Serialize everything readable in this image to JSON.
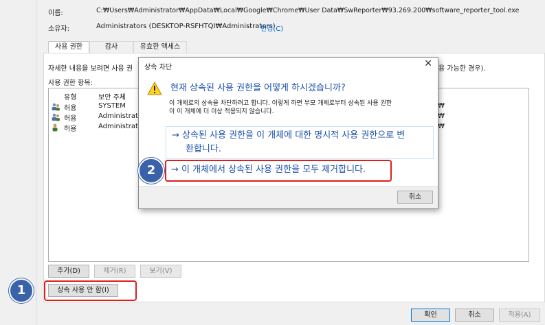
{
  "header": {
    "name_label": "이름:",
    "name_value": "C:₩Users₩Administrator₩AppData₩Local₩Google₩Chrome₩User Data₩SwReporter₩93.269.200₩software_reporter_tool.exe",
    "owner_label": "소유자:",
    "owner_value": "Administrators (DESKTOP-RSFHTQI₩Administrators)",
    "owner_change": "변경(C)"
  },
  "tabs": [
    {
      "label": "사용 권한"
    },
    {
      "label": "감사"
    },
    {
      "label": "유효한 액세스"
    }
  ],
  "permissions": {
    "info_left": "자세한 내용을 보려면 사용 권",
    "info_right": "용 가능한 경우).",
    "entries_label": "사용 권한 항목:",
    "columns": {
      "type": "유형",
      "principal": "보안 주체"
    },
    "rows": [
      {
        "type": "허용",
        "principal": "SYSTEM",
        "tail": "₩"
      },
      {
        "type": "허용",
        "principal": "Administrato",
        "tail": "₩"
      },
      {
        "type": "허용",
        "principal": "Administrato",
        "tail": "₩"
      }
    ]
  },
  "buttons": {
    "add": "추가(D)",
    "remove": "제거(R)",
    "view": "보기(V)",
    "disable_inheritance": "상속 사용 안 함(I)",
    "ok": "확인",
    "cancel": "취소",
    "apply": "적용(A)"
  },
  "dialog": {
    "title": "상속 차단",
    "close": "✕",
    "heading": "현재 상속된 사용 권한을 어떻게 하시겠습니까?",
    "description_line1": "이 개체로의 상속을 차단하려고 합니다. 이렇게 하면 부모 개체로부터 상속된 사용 권한",
    "description_line2": "이 이 개체에 더 이상 적용되지 않습니다.",
    "option_convert_line1": "→ 상속된 사용 권한을 이 개체에 대한 명시적 사용 권한으로 변",
    "option_convert_line2": "환합니다.",
    "option_remove": "→ 이 개체에서 상속된 사용 권한을 모두 제거합니다.",
    "cancel": "취소"
  },
  "markers": {
    "step1": "1",
    "step2": "2"
  },
  "colors": {
    "highlight": "#e21b1b",
    "marker": "#3a62a8",
    "link": "#1b50a8"
  }
}
